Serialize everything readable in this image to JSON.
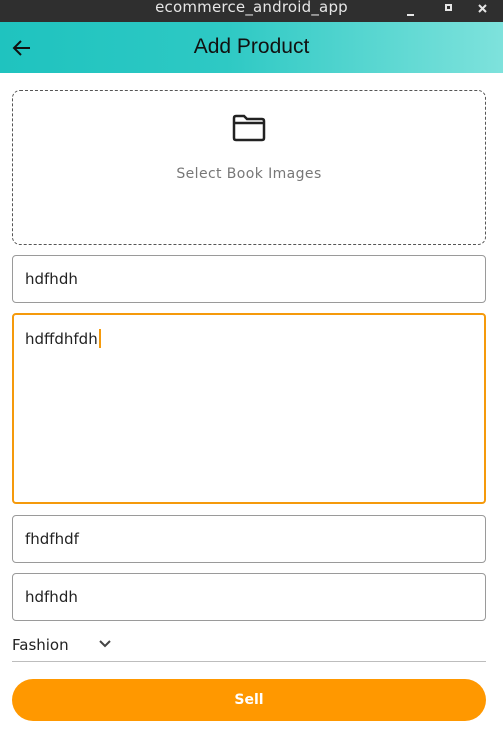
{
  "window": {
    "title": "ecommerce_android_app"
  },
  "appbar": {
    "title": "Add Product",
    "back_icon": "arrow-back-icon"
  },
  "image_picker": {
    "icon": "folder-icon",
    "label": "Select Book Images"
  },
  "form": {
    "field_1_value": "hdfhdh",
    "field_2_value": "hdffdhfdh",
    "field_3_value": "fhdfhdf",
    "field_4_value": "hdfhdh",
    "category_selected": "Fashion"
  },
  "actions": {
    "sell_label": "Sell"
  },
  "colors": {
    "accent": "#ff9800",
    "appbar_start": "#1fc3bf",
    "appbar_end": "#7ee2dc",
    "focus_border": "#f59a0c"
  }
}
